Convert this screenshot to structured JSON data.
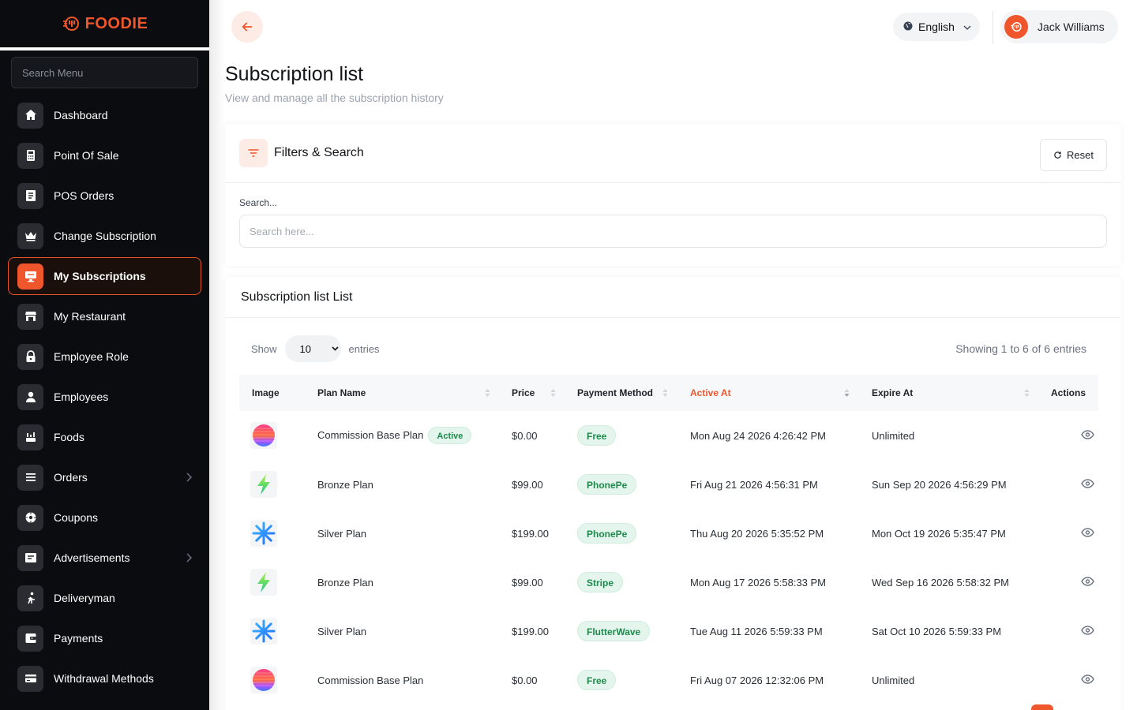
{
  "brand": {
    "name": "FOODIE",
    "color": "#f0562c"
  },
  "sidebar": {
    "search_placeholder": "Search Menu",
    "items": [
      {
        "label": "Dashboard",
        "icon": "home-icon"
      },
      {
        "label": "Point Of Sale",
        "icon": "calculator-icon"
      },
      {
        "label": "POS Orders",
        "icon": "receipt-icon"
      },
      {
        "label": "Change Subscription",
        "icon": "crown-icon"
      },
      {
        "label": "My Subscriptions",
        "icon": "monitor-icon",
        "active": true
      },
      {
        "label": "My Restaurant",
        "icon": "store-icon"
      },
      {
        "label": "Employee Role",
        "icon": "lock-icon"
      },
      {
        "label": "Employees",
        "icon": "user-icon"
      },
      {
        "label": "Foods",
        "icon": "food-icon"
      },
      {
        "label": "Orders",
        "icon": "list-icon",
        "has_submenu": true
      },
      {
        "label": "Coupons",
        "icon": "gear-icon"
      },
      {
        "label": "Advertisements",
        "icon": "ad-icon",
        "has_submenu": true
      },
      {
        "label": "Deliveryman",
        "icon": "runner-icon"
      },
      {
        "label": "Payments",
        "icon": "wallet-icon"
      },
      {
        "label": "Withdrawal Methods",
        "icon": "card-icon"
      }
    ]
  },
  "topbar": {
    "language": "English",
    "user_name": "Jack Williams"
  },
  "page": {
    "title": "Subscription list",
    "subtitle": "View and manage all the subscription history"
  },
  "filters": {
    "title": "Filters & Search",
    "reset_label": "Reset",
    "search_label": "Search...",
    "search_placeholder": "Search here..."
  },
  "list": {
    "title": "Subscription list List",
    "show_label": "Show",
    "entries_label": "entries",
    "page_size": "10",
    "showing_text": "Showing 1 to 6 of 6 entries",
    "columns": [
      "Image",
      "Plan Name",
      "Price",
      "Payment Method",
      "Active At",
      "Expire At",
      "Actions"
    ],
    "sorted_column": "Active At",
    "rows": [
      {
        "image": "gradient-sphere-icon",
        "plan": "Commission Base Plan",
        "status": "Active",
        "price": "$0.00",
        "method": "Free",
        "active_at": "Mon Aug 24 2026 4:26:42 PM",
        "expire_at": "Unlimited"
      },
      {
        "image": "lightning-icon",
        "plan": "Bronze Plan",
        "status": "",
        "price": "$99.00",
        "method": "PhonePe",
        "active_at": "Fri Aug 21 2026 4:56:31 PM",
        "expire_at": "Sun Sep 20 2026 4:56:29 PM"
      },
      {
        "image": "asterisk-icon",
        "plan": "Silver Plan",
        "status": "",
        "price": "$199.00",
        "method": "PhonePe",
        "active_at": "Thu Aug 20 2026 5:35:52 PM",
        "expire_at": "Mon Oct 19 2026 5:35:47 PM"
      },
      {
        "image": "lightning-icon",
        "plan": "Bronze Plan",
        "status": "",
        "price": "$99.00",
        "method": "Stripe",
        "active_at": "Mon Aug 17 2026 5:58:33 PM",
        "expire_at": "Wed Sep 16 2026 5:58:32 PM"
      },
      {
        "image": "asterisk-icon",
        "plan": "Silver Plan",
        "status": "",
        "price": "$199.00",
        "method": "FlutterWave",
        "active_at": "Tue Aug 11 2026 5:59:33 PM",
        "expire_at": "Sat Oct 10 2026 5:59:33 PM"
      },
      {
        "image": "gradient-sphere-icon",
        "plan": "Commission Base Plan",
        "status": "",
        "price": "$0.00",
        "method": "Free",
        "active_at": "Fri Aug 07 2026 12:32:06 PM",
        "expire_at": "Unlimited"
      }
    ]
  }
}
